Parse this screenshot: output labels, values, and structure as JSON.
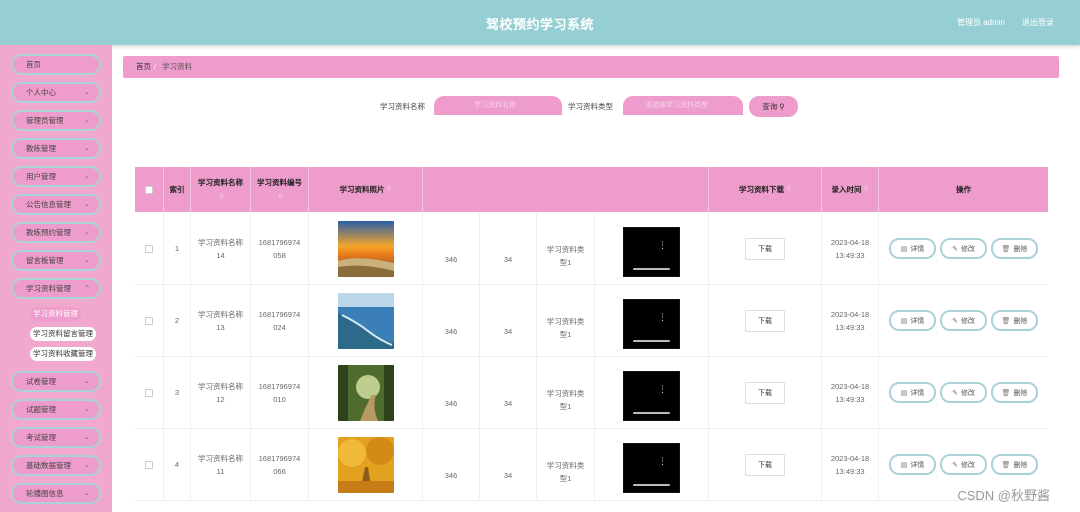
{
  "header": {
    "title": "驾校预约学习系统",
    "user_label": "管理员 admin",
    "logout_label": "退出登录"
  },
  "sidebar": {
    "items": [
      {
        "label": "首页",
        "chevron": false
      },
      {
        "label": "个人中心",
        "chevron": true
      },
      {
        "label": "管理员管理",
        "chevron": true
      },
      {
        "label": "教练管理",
        "chevron": true
      },
      {
        "label": "用户管理",
        "chevron": true
      },
      {
        "label": "公告信息管理",
        "chevron": true
      },
      {
        "label": "教练预约管理",
        "chevron": true
      },
      {
        "label": "留言板管理",
        "chevron": true
      },
      {
        "label": "学习资料管理",
        "chevron": true
      },
      {
        "label": "试卷管理",
        "chevron": true
      },
      {
        "label": "试题管理",
        "chevron": true
      },
      {
        "label": "考试管理",
        "chevron": true
      },
      {
        "label": "基础数据管理",
        "chevron": true
      },
      {
        "label": "轮播图信息",
        "chevron": true
      }
    ],
    "sub_items": [
      {
        "label": "学习资料管理",
        "active": true
      },
      {
        "label": "学习资料留言管理",
        "active": false
      },
      {
        "label": "学习资料收藏管理",
        "active": false
      }
    ]
  },
  "breadcrumb": {
    "home": "首页",
    "separator": "/",
    "current": "学习资料"
  },
  "search": {
    "name_label": "学习资料名称",
    "name_placeholder": "学习资料名称",
    "type_label": "学习资料类型",
    "type_placeholder": "请选择学习资料类型",
    "button_label": "查询 ⚲"
  },
  "table": {
    "headers": {
      "index": "索引",
      "name": "学习资料名称",
      "number": "学习资料编号",
      "photo": "学习资料照片",
      "download": "学习资料下载",
      "time": "录入时间",
      "actions": "操作"
    },
    "rows": [
      {
        "index": "1",
        "name": "学习资料名称14",
        "number": "1681796974058",
        "col_a": "346",
        "col_b": "34",
        "type": "学习资料类型1",
        "download": "下载",
        "time": "2023-04-18 13:49:33",
        "photo": "sunset-beach"
      },
      {
        "index": "2",
        "name": "学习资料名称13",
        "number": "1681796974024",
        "col_a": "346",
        "col_b": "34",
        "type": "学习资料类型1",
        "download": "下载",
        "time": "2023-04-18 13:49:33",
        "photo": "coastal-river"
      },
      {
        "index": "3",
        "name": "学习资料名称12",
        "number": "1681796974010",
        "col_a": "346",
        "col_b": "34",
        "type": "学习资料类型1",
        "download": "下载",
        "time": "2023-04-18 13:49:33",
        "photo": "forest-path"
      },
      {
        "index": "4",
        "name": "学习资料名称11",
        "number": "1681796974066",
        "col_a": "346",
        "col_b": "34",
        "type": "学习资料类型1",
        "download": "下载",
        "time": "2023-04-18 13:49:33",
        "photo": "autumn-trees"
      }
    ],
    "actions": {
      "detail": "详情",
      "edit": "修改",
      "delete": "删除"
    }
  },
  "colors": {
    "header_bg": "#96cfd3",
    "sidebar_bg": "#f1a8cf",
    "accent_pink": "#ee9ccb",
    "border_teal": "#a9d3d8"
  },
  "watermark": "CSDN @秋野酱"
}
